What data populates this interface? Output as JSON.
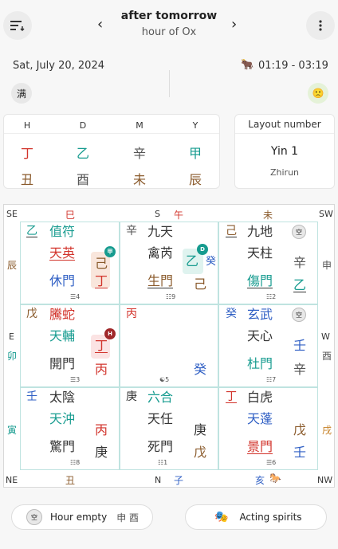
{
  "header": {
    "title": "after tomorrow",
    "subtitle": "hour of Ox",
    "prev": "‹",
    "next": "›"
  },
  "info": {
    "date": "Sat, July 20, 2024",
    "time": "01:19 - 03:19",
    "badge": "满",
    "emoji": "🙁",
    "ox": "🐂"
  },
  "pillars": {
    "heads": [
      "H",
      "D",
      "M",
      "Y"
    ],
    "stems": [
      "丁",
      "乙",
      "辛",
      "甲"
    ],
    "branches": [
      "丑",
      "酉",
      "未",
      "辰"
    ]
  },
  "layout": {
    "label": "Layout number",
    "value": "Yin 1",
    "name": "Zhirun"
  },
  "compass": {
    "se": "SE",
    "s": "S",
    "sw": "SW",
    "e": "E",
    "w": "W",
    "ne": "NE",
    "n": "N",
    "nw": "NW",
    "top_branches": [
      "巳",
      "午",
      "未"
    ],
    "left_branches": [
      "辰",
      "卯",
      "寅"
    ],
    "right_branches": [
      "申",
      "酉",
      "戌"
    ],
    "bottom_branches": [
      "丑",
      "子",
      "亥"
    ]
  },
  "palaces": [
    {
      "stem": "乙",
      "deity": "值符",
      "star": "天英",
      "door": "休門",
      "lo": "☰4",
      "heaven": "己",
      "earth": "丁",
      "tag": "甲"
    },
    {
      "stem": "辛",
      "deity": "九天",
      "star": "禽芮",
      "door": "生門",
      "lo": "☷9",
      "heaven": "乙",
      "earth": "己",
      "extra": "癸",
      "tag": "D"
    },
    {
      "stem": "己",
      "deity": "九地",
      "star": "天柱",
      "door": "傷門",
      "lo": "☷2",
      "heaven": "辛",
      "earth": "乙",
      "mark": "空"
    },
    {
      "stem": "戊",
      "deity": "騰蛇",
      "star": "天輔",
      "door": "開門",
      "lo": "☰3",
      "heaven": "丁",
      "earth": "丙",
      "tag": "H"
    },
    {
      "stem": "丙",
      "lo": "☯5",
      "earth": "癸"
    },
    {
      "stem": "癸",
      "deity": "玄武",
      "star": "天心",
      "door": "杜門",
      "lo": "☷7",
      "heaven": "壬",
      "earth": "辛",
      "mark": "空"
    },
    {
      "stem": "壬",
      "deity": "太陰",
      "star": "天沖",
      "door": "驚門",
      "lo": "☷8",
      "heaven": "丙",
      "earth": "庚"
    },
    {
      "stem": "庚",
      "deity": "六合",
      "star": "天任",
      "door": "死門",
      "lo": "☷1",
      "heaven": "庚",
      "earth": "戊"
    },
    {
      "stem": "丁",
      "deity": "白虎",
      "star": "天蓬",
      "door": "景門",
      "lo": "☰6",
      "heaven": "戊",
      "earth": "壬"
    }
  ],
  "bottom": {
    "hour_empty": "Hour empty",
    "hour_empty_chars": "申 酉",
    "acting": "Acting spirits",
    "empty_mark": "空",
    "mask_icon": "🎭",
    "horse": "🐎"
  }
}
